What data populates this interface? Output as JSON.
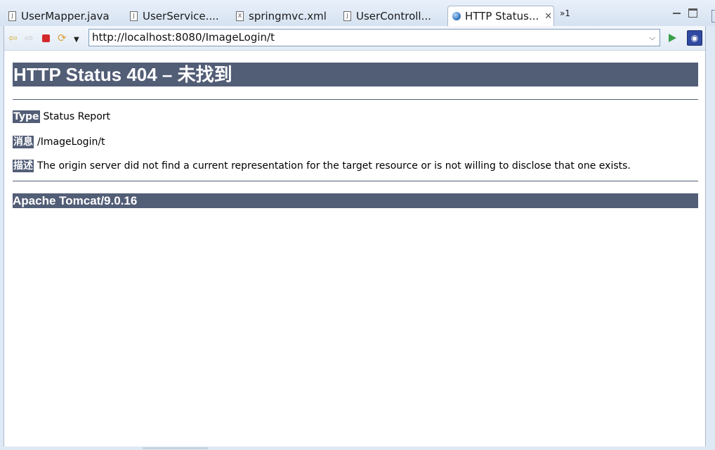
{
  "tabs": [
    {
      "label": "UserMapper.java",
      "icon": "java-file-icon"
    },
    {
      "label": "UserService....",
      "icon": "java-file-icon"
    },
    {
      "label": "springmvc.xml",
      "icon": "xml-file-icon"
    },
    {
      "label": "UserControll...",
      "icon": "java-file-icon"
    },
    {
      "label": "HTTP Status...",
      "icon": "globe-icon",
      "active": true
    }
  ],
  "overflow_label": "»1",
  "browser": {
    "url": "http://localhost:8080/ImageLogin/t"
  },
  "page": {
    "title": "HTTP Status 404 – 未找到",
    "type_label": "Type",
    "type_value": "Status Report",
    "message_label": "消息",
    "message_value": "/ImageLogin/t",
    "description_label": "描述",
    "description_value": "The origin server did not find a current representation for the target resource or is not willing to disclose that one exists.",
    "footer": "Apache Tomcat/9.0.16"
  },
  "colors": {
    "header_bg": "#525d76",
    "chrome_bg": "#dfe9f5"
  }
}
